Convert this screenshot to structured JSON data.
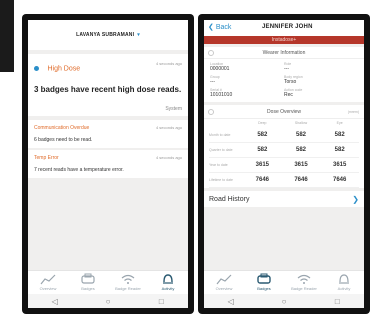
{
  "left_phone": {
    "header_user": "LAVANYA SUBRAMANI",
    "alerts": [
      {
        "title": "High Dose",
        "time": "4 seconds ago",
        "body": "3 badges have recent high dose reads.",
        "source": "System"
      },
      {
        "title": "Communication Overdue",
        "time": "4 seconds ago",
        "body": "6 badges need to be read."
      },
      {
        "title": "Temp Error",
        "time": "4 seconds ago",
        "body": "7 recent reads have a temperature error."
      }
    ],
    "tabs": [
      "Overview",
      "Badges",
      "Badge Reader",
      "Activity"
    ]
  },
  "right_phone": {
    "back_label": "Back",
    "title": "JENNIFER JOHN",
    "banner": "Instadose+",
    "wearer_header": "Wearer Information",
    "wearer_fields": [
      {
        "label": "Location",
        "value": "0000001"
      },
      {
        "label": "Role",
        "value": "---"
      },
      {
        "label": "Group",
        "value": "---"
      },
      {
        "label": "Body region",
        "value": "Torso"
      },
      {
        "label": "Serial #",
        "value": "10101010"
      },
      {
        "label": "Action code",
        "value": "Rec"
      }
    ],
    "dose_header": "Dose Overview",
    "dose_unit": "(mrem)",
    "dose_columns": [
      "Deep",
      "Shallow",
      "Eye"
    ],
    "dose_rows": [
      {
        "label": "Month to date",
        "values": [
          "582",
          "582",
          "582"
        ]
      },
      {
        "label": "Quarter to date",
        "values": [
          "582",
          "582",
          "582"
        ]
      },
      {
        "label": "Year to date",
        "values": [
          "3615",
          "3615",
          "3615"
        ]
      },
      {
        "label": "Lifetime to date",
        "values": [
          "7646",
          "7646",
          "7646"
        ]
      }
    ],
    "road_history": "Road History",
    "tabs": [
      "Overview",
      "Badges",
      "Badge Reader",
      "Activity"
    ]
  },
  "colors": {
    "accent": "#2b8fc9",
    "alert": "#e06b2a",
    "banner": "#b5362a",
    "tab_inactive": "#9aa5ae",
    "tab_active": "#2a5a72"
  }
}
